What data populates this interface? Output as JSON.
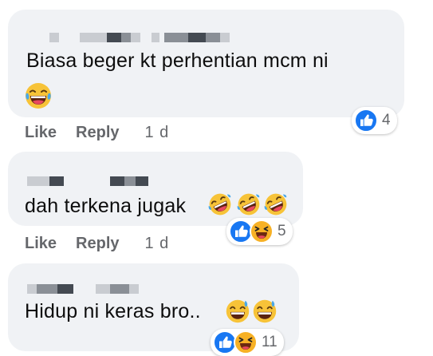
{
  "actions": {
    "like": "Like",
    "reply": "Reply"
  },
  "comments": [
    {
      "text": "Biasa beger kt perhentian mcm ni",
      "time": "1 d",
      "reaction_count": "4",
      "reactions": [
        "like-icon"
      ],
      "emoji": [
        "laugh-crying-emoji"
      ]
    },
    {
      "text": "dah terkena jugak",
      "time": "1 d",
      "reaction_count": "5",
      "reactions": [
        "like-icon",
        "haha-icon"
      ],
      "emoji": [
        "rolling-laugh-emoji",
        "rolling-laugh-emoji",
        "rolling-laugh-emoji"
      ]
    },
    {
      "text": "Hidup ni keras bro..",
      "time": "",
      "reaction_count": "11",
      "reactions": [
        "like-icon",
        "haha-icon"
      ],
      "emoji": [
        "grinning-sweat-emoji",
        "grinning-sweat-emoji"
      ]
    }
  ],
  "colors": {
    "bubble": "#f0f2f5",
    "like_blue": "#1877f2",
    "haha_yellow": "#f7b125",
    "meta_gray": "#65676b"
  }
}
